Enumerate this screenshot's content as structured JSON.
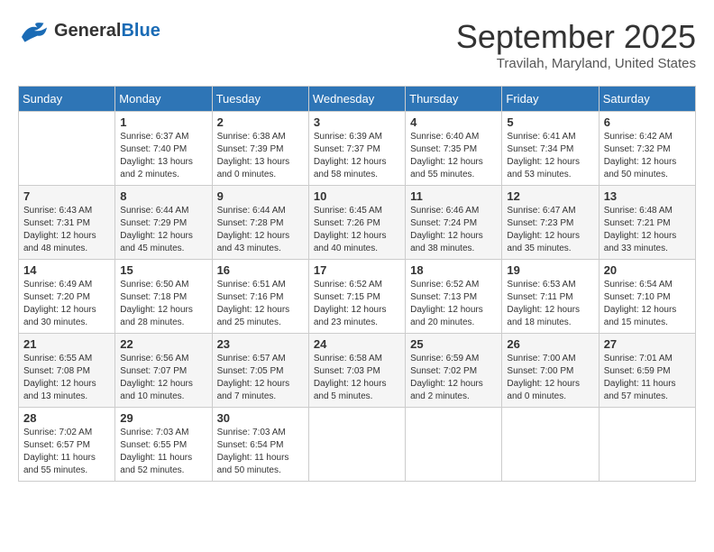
{
  "header": {
    "logo_general": "General",
    "logo_blue": "Blue",
    "month": "September 2025",
    "location": "Travilah, Maryland, United States"
  },
  "days_of_week": [
    "Sunday",
    "Monday",
    "Tuesday",
    "Wednesday",
    "Thursday",
    "Friday",
    "Saturday"
  ],
  "weeks": [
    [
      {
        "day": "",
        "sunrise": "",
        "sunset": "",
        "daylight": ""
      },
      {
        "day": "1",
        "sunrise": "Sunrise: 6:37 AM",
        "sunset": "Sunset: 7:40 PM",
        "daylight": "Daylight: 13 hours and 2 minutes."
      },
      {
        "day": "2",
        "sunrise": "Sunrise: 6:38 AM",
        "sunset": "Sunset: 7:39 PM",
        "daylight": "Daylight: 13 hours and 0 minutes."
      },
      {
        "day": "3",
        "sunrise": "Sunrise: 6:39 AM",
        "sunset": "Sunset: 7:37 PM",
        "daylight": "Daylight: 12 hours and 58 minutes."
      },
      {
        "day": "4",
        "sunrise": "Sunrise: 6:40 AM",
        "sunset": "Sunset: 7:35 PM",
        "daylight": "Daylight: 12 hours and 55 minutes."
      },
      {
        "day": "5",
        "sunrise": "Sunrise: 6:41 AM",
        "sunset": "Sunset: 7:34 PM",
        "daylight": "Daylight: 12 hours and 53 minutes."
      },
      {
        "day": "6",
        "sunrise": "Sunrise: 6:42 AM",
        "sunset": "Sunset: 7:32 PM",
        "daylight": "Daylight: 12 hours and 50 minutes."
      }
    ],
    [
      {
        "day": "7",
        "sunrise": "Sunrise: 6:43 AM",
        "sunset": "Sunset: 7:31 PM",
        "daylight": "Daylight: 12 hours and 48 minutes."
      },
      {
        "day": "8",
        "sunrise": "Sunrise: 6:44 AM",
        "sunset": "Sunset: 7:29 PM",
        "daylight": "Daylight: 12 hours and 45 minutes."
      },
      {
        "day": "9",
        "sunrise": "Sunrise: 6:44 AM",
        "sunset": "Sunset: 7:28 PM",
        "daylight": "Daylight: 12 hours and 43 minutes."
      },
      {
        "day": "10",
        "sunrise": "Sunrise: 6:45 AM",
        "sunset": "Sunset: 7:26 PM",
        "daylight": "Daylight: 12 hours and 40 minutes."
      },
      {
        "day": "11",
        "sunrise": "Sunrise: 6:46 AM",
        "sunset": "Sunset: 7:24 PM",
        "daylight": "Daylight: 12 hours and 38 minutes."
      },
      {
        "day": "12",
        "sunrise": "Sunrise: 6:47 AM",
        "sunset": "Sunset: 7:23 PM",
        "daylight": "Daylight: 12 hours and 35 minutes."
      },
      {
        "day": "13",
        "sunrise": "Sunrise: 6:48 AM",
        "sunset": "Sunset: 7:21 PM",
        "daylight": "Daylight: 12 hours and 33 minutes."
      }
    ],
    [
      {
        "day": "14",
        "sunrise": "Sunrise: 6:49 AM",
        "sunset": "Sunset: 7:20 PM",
        "daylight": "Daylight: 12 hours and 30 minutes."
      },
      {
        "day": "15",
        "sunrise": "Sunrise: 6:50 AM",
        "sunset": "Sunset: 7:18 PM",
        "daylight": "Daylight: 12 hours and 28 minutes."
      },
      {
        "day": "16",
        "sunrise": "Sunrise: 6:51 AM",
        "sunset": "Sunset: 7:16 PM",
        "daylight": "Daylight: 12 hours and 25 minutes."
      },
      {
        "day": "17",
        "sunrise": "Sunrise: 6:52 AM",
        "sunset": "Sunset: 7:15 PM",
        "daylight": "Daylight: 12 hours and 23 minutes."
      },
      {
        "day": "18",
        "sunrise": "Sunrise: 6:52 AM",
        "sunset": "Sunset: 7:13 PM",
        "daylight": "Daylight: 12 hours and 20 minutes."
      },
      {
        "day": "19",
        "sunrise": "Sunrise: 6:53 AM",
        "sunset": "Sunset: 7:11 PM",
        "daylight": "Daylight: 12 hours and 18 minutes."
      },
      {
        "day": "20",
        "sunrise": "Sunrise: 6:54 AM",
        "sunset": "Sunset: 7:10 PM",
        "daylight": "Daylight: 12 hours and 15 minutes."
      }
    ],
    [
      {
        "day": "21",
        "sunrise": "Sunrise: 6:55 AM",
        "sunset": "Sunset: 7:08 PM",
        "daylight": "Daylight: 12 hours and 13 minutes."
      },
      {
        "day": "22",
        "sunrise": "Sunrise: 6:56 AM",
        "sunset": "Sunset: 7:07 PM",
        "daylight": "Daylight: 12 hours and 10 minutes."
      },
      {
        "day": "23",
        "sunrise": "Sunrise: 6:57 AM",
        "sunset": "Sunset: 7:05 PM",
        "daylight": "Daylight: 12 hours and 7 minutes."
      },
      {
        "day": "24",
        "sunrise": "Sunrise: 6:58 AM",
        "sunset": "Sunset: 7:03 PM",
        "daylight": "Daylight: 12 hours and 5 minutes."
      },
      {
        "day": "25",
        "sunrise": "Sunrise: 6:59 AM",
        "sunset": "Sunset: 7:02 PM",
        "daylight": "Daylight: 12 hours and 2 minutes."
      },
      {
        "day": "26",
        "sunrise": "Sunrise: 7:00 AM",
        "sunset": "Sunset: 7:00 PM",
        "daylight": "Daylight: 12 hours and 0 minutes."
      },
      {
        "day": "27",
        "sunrise": "Sunrise: 7:01 AM",
        "sunset": "Sunset: 6:59 PM",
        "daylight": "Daylight: 11 hours and 57 minutes."
      }
    ],
    [
      {
        "day": "28",
        "sunrise": "Sunrise: 7:02 AM",
        "sunset": "Sunset: 6:57 PM",
        "daylight": "Daylight: 11 hours and 55 minutes."
      },
      {
        "day": "29",
        "sunrise": "Sunrise: 7:03 AM",
        "sunset": "Sunset: 6:55 PM",
        "daylight": "Daylight: 11 hours and 52 minutes."
      },
      {
        "day": "30",
        "sunrise": "Sunrise: 7:03 AM",
        "sunset": "Sunset: 6:54 PM",
        "daylight": "Daylight: 11 hours and 50 minutes."
      },
      {
        "day": "",
        "sunrise": "",
        "sunset": "",
        "daylight": ""
      },
      {
        "day": "",
        "sunrise": "",
        "sunset": "",
        "daylight": ""
      },
      {
        "day": "",
        "sunrise": "",
        "sunset": "",
        "daylight": ""
      },
      {
        "day": "",
        "sunrise": "",
        "sunset": "",
        "daylight": ""
      }
    ]
  ]
}
